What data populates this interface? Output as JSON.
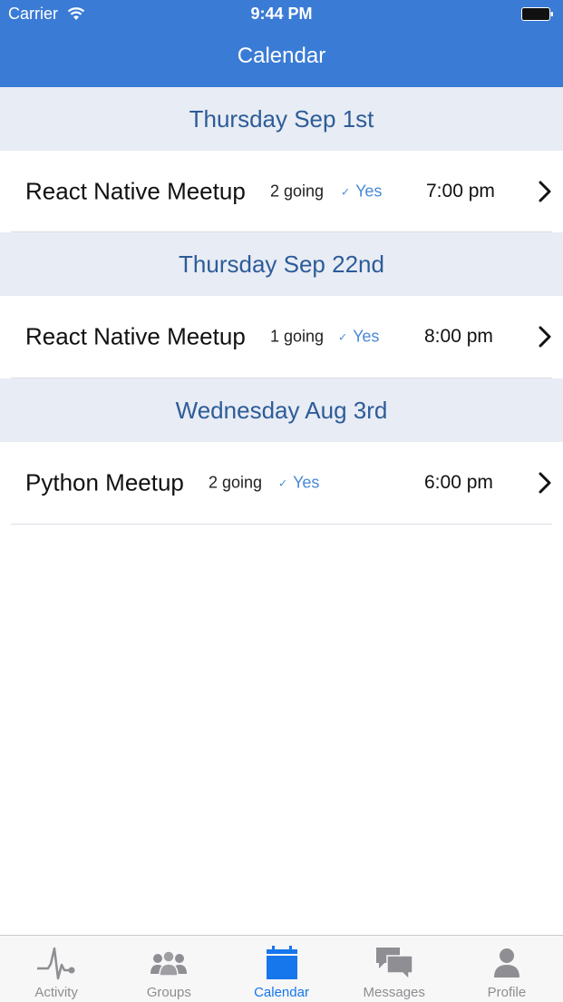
{
  "status_bar": {
    "carrier": "Carrier",
    "time": "9:44 PM"
  },
  "nav": {
    "title": "Calendar"
  },
  "sections": [
    {
      "date": "Thursday Sep 1st",
      "event": {
        "title": "React Native Meetup",
        "going": "2 going",
        "check": "✓",
        "rsvp": "Yes",
        "time": "7:00 pm"
      }
    },
    {
      "date": "Thursday Sep 22nd",
      "event": {
        "title": "React Native Meetup",
        "going": "1 going",
        "check": "✓",
        "rsvp": "Yes",
        "time": "8:00 pm"
      }
    },
    {
      "date": "Wednesday Aug 3rd",
      "event": {
        "title": "Python Meetup",
        "going": "2 going",
        "check": "✓",
        "rsvp": "Yes",
        "time": "6:00 pm"
      }
    }
  ],
  "tabs": [
    {
      "label": "Activity",
      "icon": "activity-icon"
    },
    {
      "label": "Groups",
      "icon": "groups-icon"
    },
    {
      "label": "Calendar",
      "icon": "calendar-icon",
      "active": true
    },
    {
      "label": "Messages",
      "icon": "messages-icon"
    },
    {
      "label": "Profile",
      "icon": "profile-icon"
    }
  ],
  "colors": {
    "nav_bar": "#3a7bd5",
    "section_bg": "#e8ecf4",
    "section_text": "#2d5c99",
    "rsvp": "#4a8ad6",
    "tab_active": "#1676ec",
    "tab_inactive": "#8e8e93"
  }
}
